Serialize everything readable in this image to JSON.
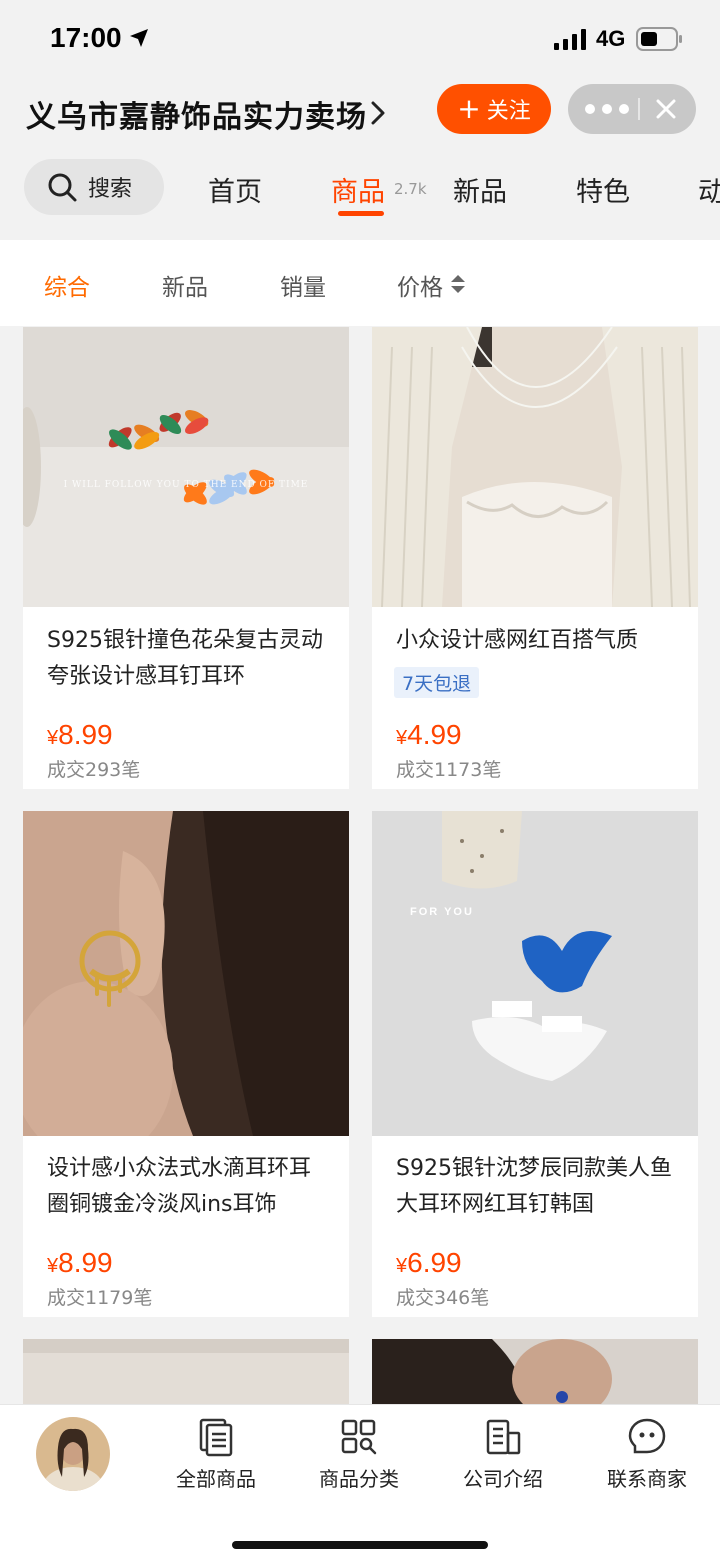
{
  "status_bar": {
    "time": "17:00",
    "network": "4G"
  },
  "header": {
    "shop_name": "义乌市嘉静饰品实力卖场",
    "follow_label": "关注",
    "search_label": "搜索",
    "tabs": [
      {
        "label": "首页"
      },
      {
        "label": "商品",
        "count": "2.7k",
        "active": true
      },
      {
        "label": "新品"
      },
      {
        "label": "特色"
      },
      {
        "label": "动"
      }
    ]
  },
  "sort_bar": {
    "items": [
      {
        "label": "综合",
        "active": true
      },
      {
        "label": "新品"
      },
      {
        "label": "销量"
      },
      {
        "label": "价格"
      }
    ]
  },
  "products": [
    {
      "title": "S925银针撞色花朵复古灵动夸张设计感耳钉耳环",
      "tag": "",
      "currency": "¥",
      "price": "8.99",
      "sold": "成交293笔",
      "image_text": "I WILL FOLLOW YOU TO THE END OF TIME"
    },
    {
      "title": "小众设计感网红百搭气质",
      "tag": "7天包退",
      "currency": "¥",
      "price": "4.99",
      "sold": "成交1173笔",
      "image_text": ""
    },
    {
      "title": "设计感小众法式水滴耳环耳圈铜镀金冷淡风ins耳饰",
      "tag": "",
      "currency": "¥",
      "price": "8.99",
      "sold": "成交1179笔",
      "image_text": ""
    },
    {
      "title": "S925银针沈梦辰同款美人鱼大耳环网红耳钉韩国",
      "tag": "",
      "currency": "¥",
      "price": "6.99",
      "sold": "成交346笔",
      "image_text": "FOR YOU"
    }
  ],
  "bottom_bar": {
    "items": [
      {
        "label": "全部商品",
        "icon": "all-products-icon"
      },
      {
        "label": "商品分类",
        "icon": "category-icon"
      },
      {
        "label": "公司介绍",
        "icon": "company-icon"
      },
      {
        "label": "联系商家",
        "icon": "contact-icon"
      }
    ]
  },
  "colors": {
    "accent": "#ff5000",
    "price": "#ff4400",
    "tag_bg": "#eaf1fb",
    "tag_text": "#3a6fc4"
  }
}
